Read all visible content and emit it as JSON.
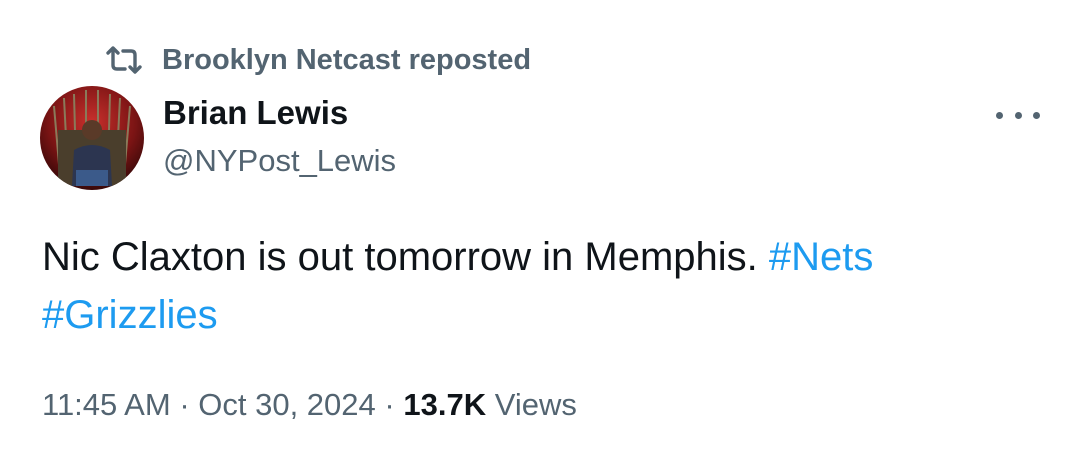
{
  "repost": {
    "icon": "repost-icon",
    "text": "Brooklyn Netcast reposted"
  },
  "author": {
    "name": "Brian Lewis",
    "handle": "@NYPost_Lewis",
    "avatar_icon": "avatar"
  },
  "more_icon": "more-horizontal-icon",
  "tweet": {
    "text": "Nic Claxton is out tomorrow in Memphis.",
    "hashtags": [
      "#Nets",
      "#Grizzlies"
    ]
  },
  "meta": {
    "time": "11:45 AM",
    "separator": "·",
    "date": "Oct 30, 2024",
    "views_count": "13.7K",
    "views_label": "Views"
  },
  "colors": {
    "text_primary": "#0f1419",
    "text_secondary": "#536471",
    "hashtag": "#1d9bf0"
  }
}
